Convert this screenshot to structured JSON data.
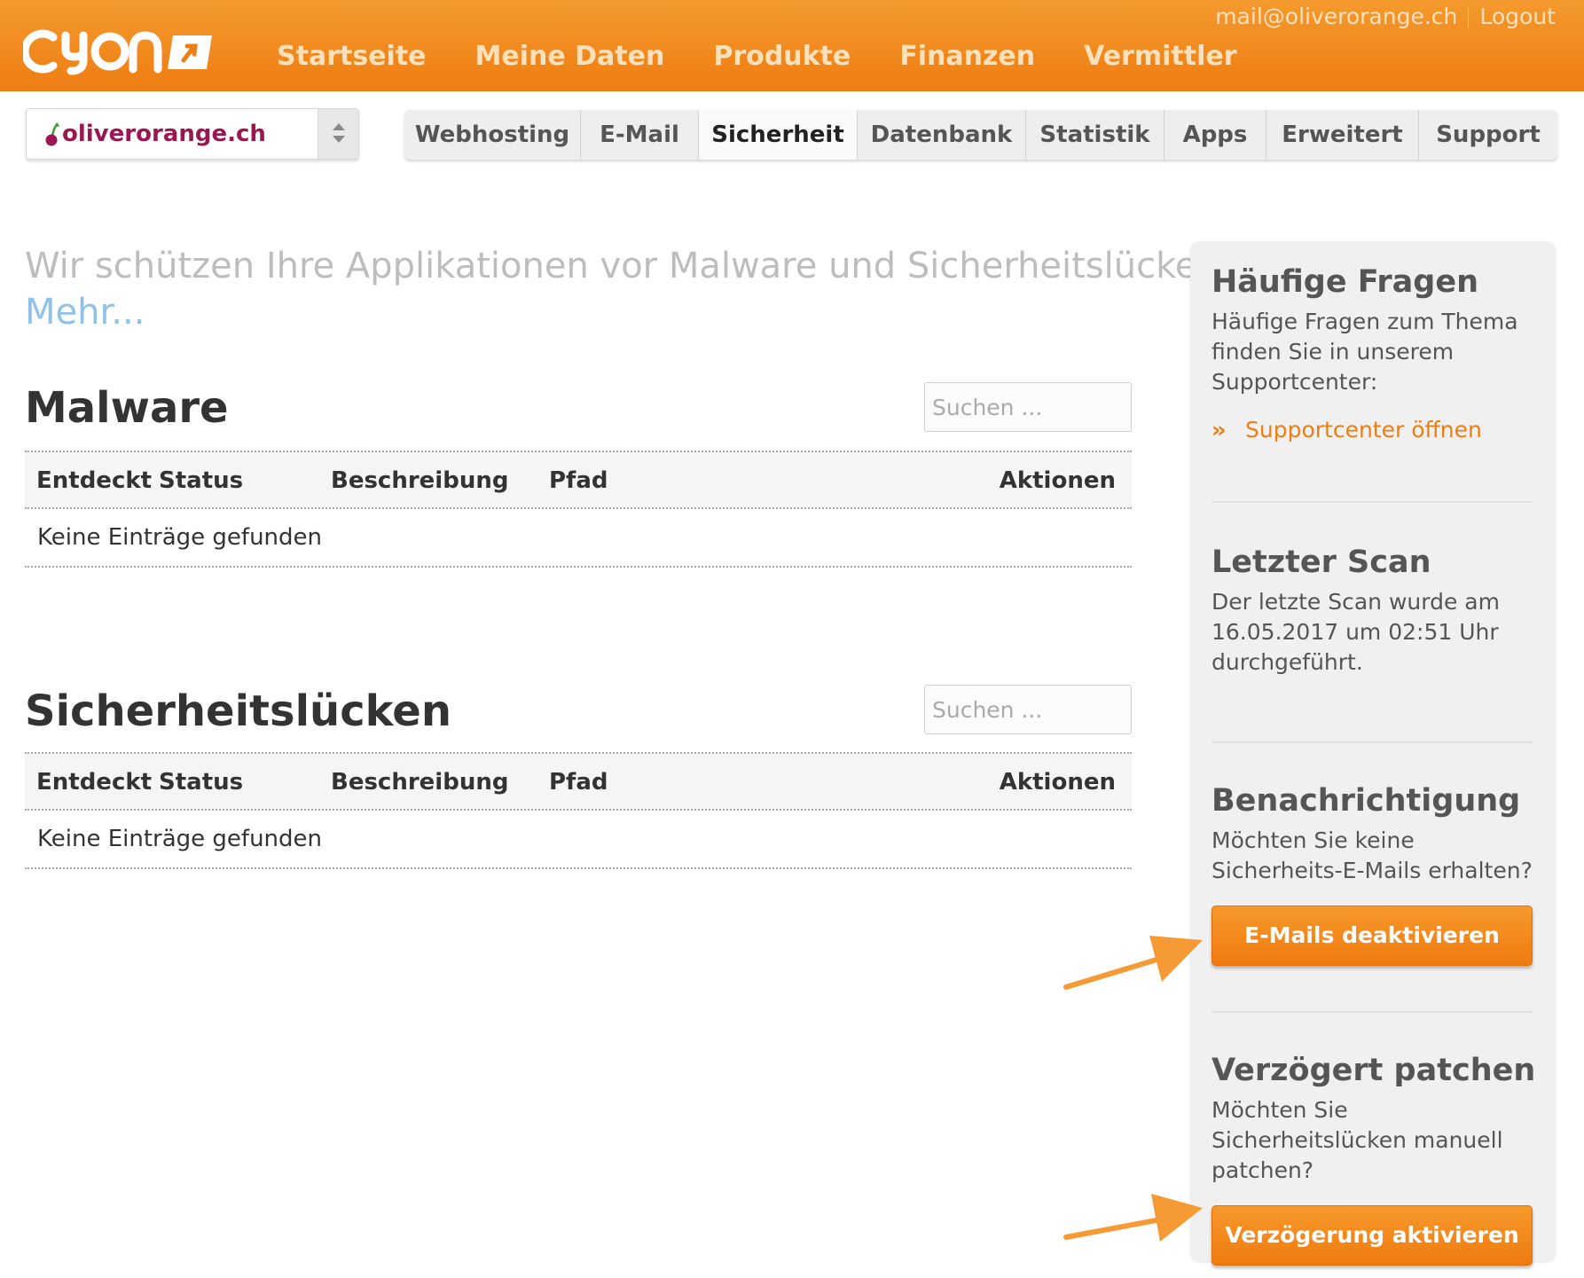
{
  "header": {
    "logo_text": "CYON",
    "nav": [
      "Startseite",
      "Meine Daten",
      "Produkte",
      "Finanzen",
      "Vermittler"
    ],
    "user_email": "mail@oliverorange.ch",
    "logout": "Logout"
  },
  "domain_select": {
    "value": "oliverorange.ch"
  },
  "tabs": {
    "items": [
      "Webhosting",
      "E-Mail",
      "Sicherheit",
      "Datenbank",
      "Statistik",
      "Apps",
      "Erweitert",
      "Support"
    ],
    "active": "Sicherheit"
  },
  "intro": {
    "text": "Wir schützen Ihre Applikationen vor Malware und Sicherheitslücken.",
    "more": "Mehr..."
  },
  "sections": [
    {
      "title": "Malware",
      "search_placeholder": "Suchen ...",
      "columns": [
        "Entdeckt",
        "Status",
        "Beschreibung",
        "Pfad",
        "Aktionen"
      ],
      "empty_text": "Keine Einträge gefunden"
    },
    {
      "title": "Sicherheitslücken",
      "search_placeholder": "Suchen ...",
      "columns": [
        "Entdeckt",
        "Status",
        "Beschreibung",
        "Pfad",
        "Aktionen"
      ],
      "empty_text": "Keine Einträge gefunden"
    }
  ],
  "sidebar": {
    "faq": {
      "title": "Häufige Fragen",
      "text": "Häufige Fragen zum Thema finden Sie in unserem Supportcenter:",
      "link": "Supportcenter öffnen"
    },
    "last_scan": {
      "title": "Letzter Scan",
      "text": "Der letzte Scan wurde am 16.05.2017 um 02:51 Uhr durchgeführt."
    },
    "notification": {
      "title": "Benachrichtigung",
      "text": "Möchten Sie keine Sicherheits-E-Mails erhalten?",
      "button": "E-Mails deaktivieren"
    },
    "delayed_patch": {
      "title": "Verzögert patchen",
      "text": "Möchten Sie Sicherheitslücken manuell patchen?",
      "button": "Verzögerung aktivieren"
    }
  },
  "colors": {
    "brand_orange": "#ee7d12",
    "link_blue": "#8ec2e8",
    "domain_magenta": "#9b1751"
  }
}
